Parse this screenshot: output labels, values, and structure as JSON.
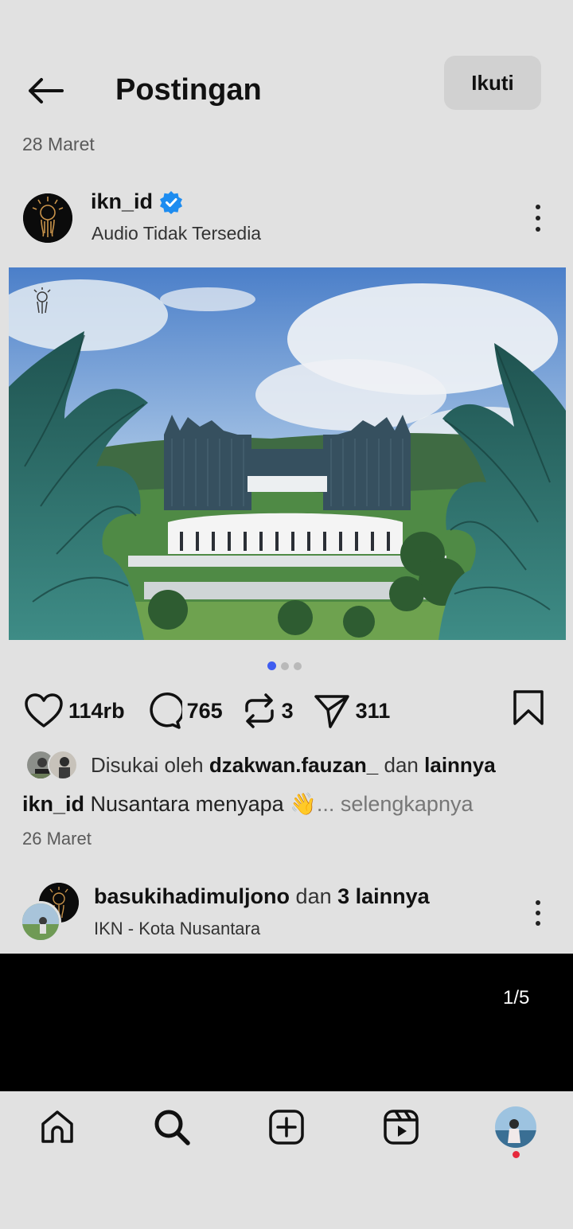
{
  "header": {
    "title": "Postingan",
    "follow_label": "Ikuti",
    "back_icon": "arrow-left-icon"
  },
  "post": {
    "date_top": "28 Maret",
    "username": "ikn_id",
    "verified": true,
    "subtitle": "Audio Tidak Tersedia",
    "pager": {
      "count": 3,
      "active": 1
    },
    "actions": {
      "likes": "114rb",
      "comments": "765",
      "reposts": "3",
      "shares": "311"
    },
    "liked_by": {
      "prefix": "Disukai oleh",
      "user": "dzakwan.fauzan_",
      "conj": "dan",
      "others": "lainnya"
    },
    "caption": {
      "user": "ikn_id",
      "text": "Nusantara menyapa 👋",
      "ellipsis": "...",
      "more": "selengkapnya"
    },
    "date_bottom": "26 Maret"
  },
  "next_post": {
    "user": "basukihadimuljono",
    "conj": "dan",
    "others": "3 lainnya",
    "location": "IKN - Kota Nusantara",
    "counter": "1/5"
  },
  "nav": {
    "items": [
      "home-icon",
      "search-icon",
      "create-icon",
      "reels-icon",
      "profile-avatar"
    ]
  },
  "colors": {
    "background": "#e1e1e1",
    "verified": "#1d8cf0",
    "pager_active": "#3f5df0",
    "notification": "#e6283c"
  }
}
